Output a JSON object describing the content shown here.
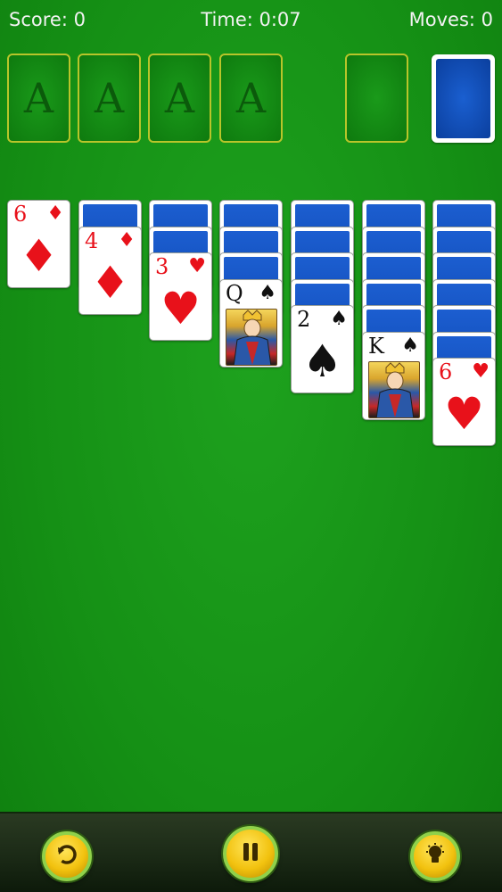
{
  "hud": {
    "score_label": "Score: 0",
    "time_label": "Time: 0:07",
    "moves_label": "Moves: 0"
  },
  "foundations": [
    {
      "label": "A"
    },
    {
      "label": "A"
    },
    {
      "label": "A"
    },
    {
      "label": "A"
    }
  ],
  "tableau": [
    {
      "hidden": 0,
      "top": {
        "rank": "6",
        "suit": "♦",
        "color": "red",
        "face": false
      }
    },
    {
      "hidden": 1,
      "top": {
        "rank": "4",
        "suit": "♦",
        "color": "red",
        "face": false
      }
    },
    {
      "hidden": 2,
      "top": {
        "rank": "3",
        "suit": "♥",
        "color": "red",
        "face": false
      }
    },
    {
      "hidden": 3,
      "top": {
        "rank": "Q",
        "suit": "♠",
        "color": "black",
        "face": true
      }
    },
    {
      "hidden": 4,
      "top": {
        "rank": "2",
        "suit": "♠",
        "color": "black",
        "face": false
      }
    },
    {
      "hidden": 5,
      "top": {
        "rank": "K",
        "suit": "♠",
        "color": "black",
        "face": true
      }
    },
    {
      "hidden": 6,
      "top": {
        "rank": "6",
        "suit": "♥",
        "color": "red",
        "face": false
      }
    }
  ],
  "controls": {
    "undo": "undo-icon",
    "pause": "pause-icon",
    "hint": "lightbulb-icon"
  },
  "colors": {
    "felt": "#159015",
    "card_back": "#0d46b0",
    "slot_border": "#b8c52a",
    "button": "#f2c20f"
  }
}
